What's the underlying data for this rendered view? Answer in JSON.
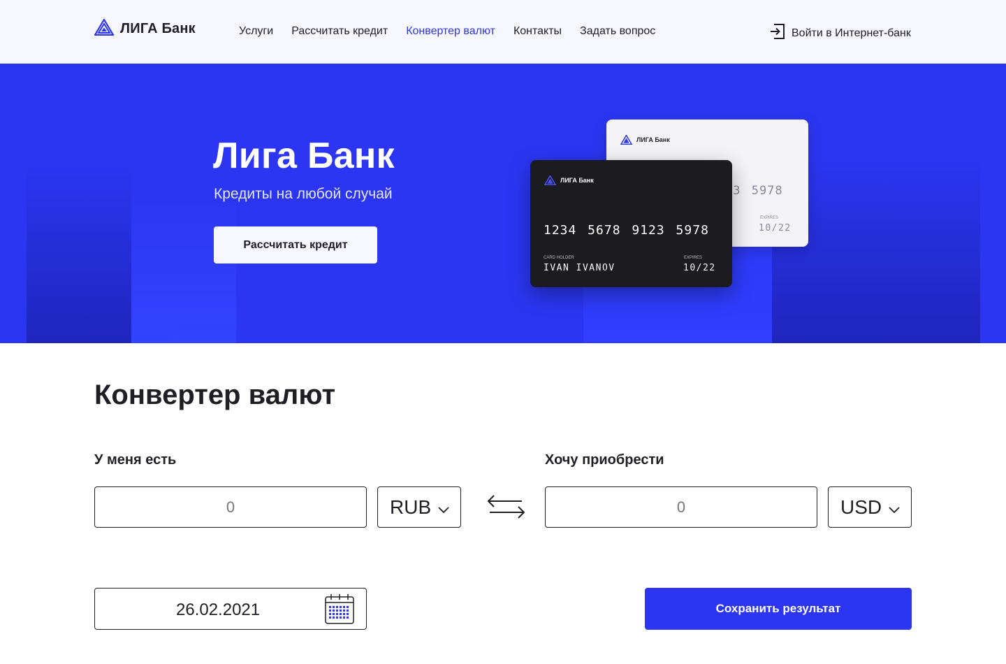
{
  "header": {
    "logo_text": "ЛИГА Банк",
    "nav": [
      "Услуги",
      "Рассчитать кредит",
      "Конвертер валют",
      "Контакты",
      "Задать вопрос"
    ],
    "active_nav": "Конвертер валют",
    "login_label": "Войти в Интернет-банк"
  },
  "hero": {
    "title": "Лига Банк",
    "subtitle": "Кредиты на любой случай",
    "button_label": "Рассчитать кредит",
    "cards": [
      {
        "theme": "white",
        "logo_text": "ЛИГА Банк",
        "number_visible": "23 5978",
        "expires_label": "EXPIRES",
        "expires": "10/22"
      },
      {
        "theme": "black",
        "logo_text": "ЛИГА Банк",
        "number": "1234 5678 9123 5978",
        "holder_label": "CARD HOLDER",
        "holder": "IVAN IVANOV",
        "expires_label": "EXPIRES",
        "expires": "10/22"
      }
    ]
  },
  "converter": {
    "title": "Конвертер валют",
    "have_label": "У меня есть",
    "want_label": "Хочу приобрести",
    "have_value": "0",
    "want_value": "0",
    "have_currency": "RUB",
    "want_currency": "USD",
    "date": "26.02.2021",
    "save_label": "Сохранить результат"
  },
  "colors": {
    "accent": "#2c36f2",
    "text": "#1f1e25",
    "header_bg": "#f6f7ff"
  },
  "icons": [
    "logo-icon",
    "login-icon",
    "chevron-down-icon",
    "swap-arrows-icon",
    "calendar-icon"
  ]
}
